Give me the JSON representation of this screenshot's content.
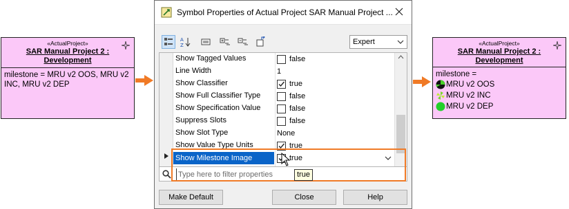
{
  "left_box": {
    "stereotype": "«ActualProject»",
    "name": "SAR Manual Project 2 : Development",
    "body": "milestone = MRU v2 OOS, MRU v2 INC, MRU v2 DEP"
  },
  "right_box": {
    "stereotype": "«ActualProject»",
    "name": "SAR Manual Project 2 : Development",
    "milestone_label": "milestone =",
    "milestones": [
      {
        "label": "MRU v2 OOS",
        "icon": "progress-pie-icon"
      },
      {
        "label": "MRU v2 INC",
        "icon": "pinwheel-icon"
      },
      {
        "label": "MRU v2 DEP",
        "icon": "green-circle-icon"
      }
    ]
  },
  "dialog": {
    "title": "Symbol Properties of Actual Project SAR Manual Project ...",
    "mode": "Expert",
    "properties": [
      {
        "name": "Show Tagged Values",
        "value": "false",
        "checkbox": true,
        "checked": false
      },
      {
        "name": "Line Width",
        "value": "1",
        "checkbox": false
      },
      {
        "name": "Show Classifier",
        "value": "true",
        "checkbox": true,
        "checked": true
      },
      {
        "name": "Show Full Classifier Type",
        "value": "false",
        "checkbox": true,
        "checked": false
      },
      {
        "name": "Show Specification Value",
        "value": "false",
        "checkbox": true,
        "checked": false
      },
      {
        "name": "Suppress Slots",
        "value": "false",
        "checkbox": true,
        "checked": false
      },
      {
        "name": "Show Slot Type",
        "value": "None",
        "checkbox": false
      },
      {
        "name": "Show Value Type Units",
        "value": "true",
        "checkbox": true,
        "checked": true
      },
      {
        "name": "Show Milestone Image",
        "value": "true",
        "checkbox": true,
        "checked": true
      }
    ],
    "filter_placeholder": "Type here to filter properties",
    "tooltip": "true",
    "buttons": {
      "make_default": "Make Default",
      "close": "Close",
      "help": "Help"
    }
  },
  "colors": {
    "box_fill": "#fbc8f8",
    "arrow": "#f07a26",
    "selection": "#0a64c8"
  }
}
